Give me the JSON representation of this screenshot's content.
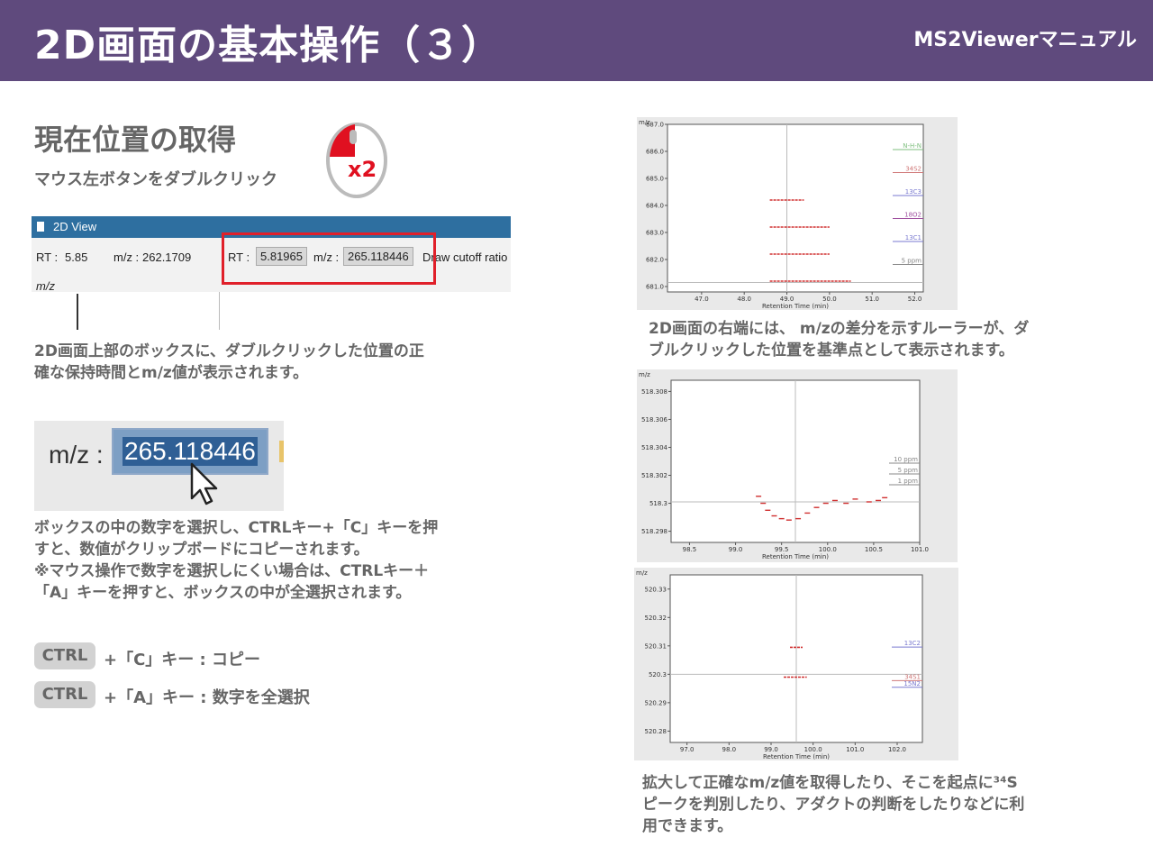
{
  "header": {
    "title": "2D画面の基本操作（３）",
    "brand": "MS2Viewerマニュアル"
  },
  "section": {
    "title": "現在位置の取得",
    "subtitle": "マウス左ボタンをダブルクリック",
    "mouse_badge": "x2"
  },
  "view2d": {
    "window_title": "2D View",
    "rt_label": "RT :",
    "rt_value": "5.85",
    "mz_label": "m/z :",
    "mz_value": "262.1709",
    "box_rt_label": "RT :",
    "box_rt_value": "5.81965",
    "box_mz_label": "m/z :",
    "box_mz_value": "265.118446",
    "draw_cutoff_label": "Draw cutoff ratio",
    "axis_label": "m/z"
  },
  "caption_1": [
    "2D画面上部のボックスに、ダブルクリックした位置の正",
    "確な保持時間とm/z値が表示されます。"
  ],
  "mz_zoom": {
    "label": "m/z :",
    "value": "265.118446"
  },
  "caption_2": [
    "ボックスの中の数字を選択し、CTRLキー+「C」キーを押",
    "すと、数値がクリップボードにコピーされます。",
    "※マウス操作で数字を選択しにくい場合は、CTRLキー＋",
    "「A」キーを押すと、ボックスの中が全選択されます。"
  ],
  "shortcuts": [
    {
      "key": "CTRL",
      "desc": "+「C」キー : コピー"
    },
    {
      "key": "CTRL",
      "desc": "+「A」キー : 数字を全選択"
    }
  ],
  "caption_3": [
    "2D画面の右端には、 m/zの差分を示すルーラーが、ダ",
    "ブルクリックした位置を基準点として表示されます。"
  ],
  "caption_4": [
    "拡大して正確なm/z値を取得したり、そこを起点に³⁴S",
    "ピークを判別したり、アダクトの判断をしたりなどに利",
    "用できます。"
  ],
  "chart_data": [
    {
      "type": "scatter",
      "ylabel": "m/z",
      "xlabel": "Retention Time (min)",
      "xlim": [
        46.2,
        52.2
      ],
      "ylim": [
        680.8,
        687.0
      ],
      "x_ticks": [
        "47.0",
        "48.0",
        "49.0",
        "50.0",
        "51.0",
        "52.0"
      ],
      "y_ticks": [
        "687.0",
        "686.0",
        "685.0",
        "684.0",
        "683.0",
        "682.0",
        "681.0"
      ],
      "crosshair": {
        "x": 49.0,
        "y": 681.15
      },
      "peaks": [
        {
          "x0": 48.6,
          "x1": 49.4,
          "y": 684.2
        },
        {
          "x0": 48.6,
          "x1": 50.0,
          "y": 683.2
        },
        {
          "x0": 48.6,
          "x1": 50.0,
          "y": 682.2
        },
        {
          "x0": 48.6,
          "x1": 50.5,
          "y": 681.2
        }
      ],
      "ruler_labels": [
        {
          "label": "N-H-N",
          "color": "#7fbf7f"
        },
        {
          "label": "34S2",
          "color": "#d07a7a"
        },
        {
          "label": "13C3",
          "color": "#7a7ad0"
        },
        {
          "label": "18O2",
          "color": "#a050a0"
        },
        {
          "label": "13C1",
          "color": "#7a7ad0"
        },
        {
          "label": "5 ppm",
          "color": "#888888"
        }
      ]
    },
    {
      "type": "scatter",
      "ylabel": "m/z",
      "xlabel": "Retention Time (min)",
      "xlim": [
        98.3,
        101.0
      ],
      "ylim": [
        518.2972,
        518.3088
      ],
      "x_ticks": [
        "98.5",
        "99.0",
        "99.5",
        "100.0",
        "100.5",
        "101.0"
      ],
      "y_ticks": [
        "518.308",
        "518.306",
        "518.304",
        "518.302",
        "518.3",
        "518.298"
      ],
      "crosshair": {
        "x": 99.65,
        "y": 518.3001
      },
      "points": [
        [
          99.25,
          518.3005
        ],
        [
          99.3,
          518.3
        ],
        [
          99.35,
          518.2995
        ],
        [
          99.42,
          518.2991
        ],
        [
          99.5,
          518.2989
        ],
        [
          99.58,
          518.2988
        ],
        [
          99.68,
          518.2989
        ],
        [
          99.78,
          518.2993
        ],
        [
          99.88,
          518.2997
        ],
        [
          99.98,
          518.3
        ],
        [
          100.08,
          518.3002
        ],
        [
          100.2,
          518.3
        ],
        [
          100.3,
          518.3003
        ],
        [
          100.45,
          518.3001
        ],
        [
          100.55,
          518.3002
        ],
        [
          100.62,
          518.3004
        ]
      ],
      "ruler_labels": [
        {
          "label": "10 ppm",
          "color": "#888888"
        },
        {
          "label": "5 ppm",
          "color": "#888888"
        },
        {
          "label": "1 ppm",
          "color": "#888888"
        }
      ]
    },
    {
      "type": "scatter",
      "ylabel": "m/z",
      "xlabel": "Retention Time (min)",
      "xlim": [
        96.6,
        102.6
      ],
      "ylim": [
        520.276,
        520.335
      ],
      "x_ticks": [
        "97.0",
        "98.0",
        "99.0",
        "100.0",
        "101.0",
        "102.0"
      ],
      "y_ticks": [
        "520.33",
        "520.32",
        "520.31",
        "520.3",
        "520.29",
        "520.28"
      ],
      "crosshair": {
        "x": 99.6,
        "y": 520.3
      },
      "peaks": [
        {
          "x0": 99.3,
          "x1": 99.85,
          "y": 520.299
        },
        {
          "x0": 99.45,
          "x1": 99.75,
          "y": 520.3095
        }
      ],
      "ruler_labels": [
        {
          "label": "13C2",
          "color": "#7a7ad0"
        },
        {
          "label": "34S1",
          "color": "#d07a7a"
        },
        {
          "label": "15N2",
          "color": "#7a7ad0"
        }
      ]
    }
  ]
}
